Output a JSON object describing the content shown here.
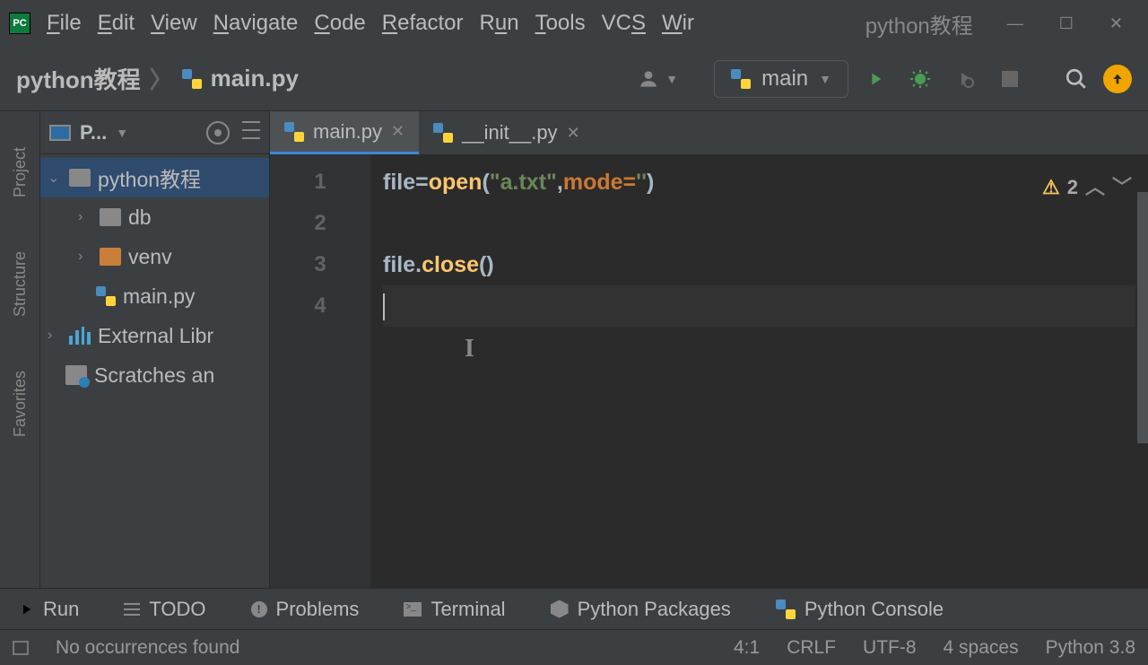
{
  "window_title": "python教程",
  "menu": {
    "file": "File",
    "edit": "Edit",
    "view": "View",
    "navigate": "Navigate",
    "code": "Code",
    "refactor": "Refactor",
    "run": "Run",
    "tools": "Tools",
    "vcs": "VCS",
    "window": "Wir"
  },
  "breadcrumb": {
    "project": "python教程",
    "file": "main.py"
  },
  "run_config": "main",
  "tabs": [
    {
      "label": "main.py",
      "active": true
    },
    {
      "label": "__init__.py",
      "active": false
    }
  ],
  "project_panel": {
    "title": "P...",
    "root": "python教程",
    "items": [
      {
        "label": "db",
        "type": "folder"
      },
      {
        "label": "venv",
        "type": "folder-orange"
      },
      {
        "label": "main.py",
        "type": "pyfile"
      }
    ],
    "external": "External Libr",
    "scratches": "Scratches an"
  },
  "gutter": [
    "1",
    "2",
    "3",
    "4"
  ],
  "code_tokens": {
    "l1": {
      "file": "file",
      "eq": "=",
      "open": "open",
      "p1": "(",
      "str1": "\"a.txt\"",
      "comma": ",",
      "mode": "mode",
      "eq2": "=",
      "str2": "''",
      "p2": ")"
    },
    "l3": {
      "file": "file",
      "dot": ".",
      "close": "close",
      "p1": "(",
      "p2": ")"
    }
  },
  "inspection": {
    "count": "2"
  },
  "left_tabs": {
    "project": "Project",
    "structure": "Structure",
    "favorites": "Favorites"
  },
  "bottom": {
    "run": "Run",
    "todo": "TODO",
    "problems": "Problems",
    "terminal": "Terminal",
    "packages": "Python Packages",
    "console": "Python Console"
  },
  "status": {
    "msg": "No occurrences found",
    "pos": "4:1",
    "lineend": "CRLF",
    "encoding": "UTF-8",
    "indent": "4 spaces",
    "python": "Python 3.8"
  }
}
